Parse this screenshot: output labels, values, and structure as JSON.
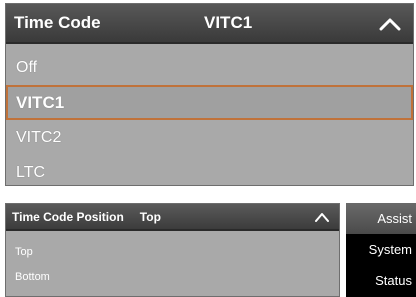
{
  "timecode_menu": {
    "label": "Time Code",
    "value": "VITC1",
    "collapse_icon": "chevron-up-icon",
    "options": [
      "Off",
      "VITC1",
      "VITC2",
      "LTC"
    ],
    "selected": "VITC1",
    "highlight_color": "#c0723a"
  },
  "position_menu": {
    "label": "Time Code Position",
    "value": "Top",
    "collapse_icon": "chevron-up-icon",
    "options": [
      "Top",
      "Bottom"
    ]
  },
  "side_menu": {
    "items": [
      "Assist",
      "System",
      "Status"
    ],
    "active": "Assist"
  }
}
